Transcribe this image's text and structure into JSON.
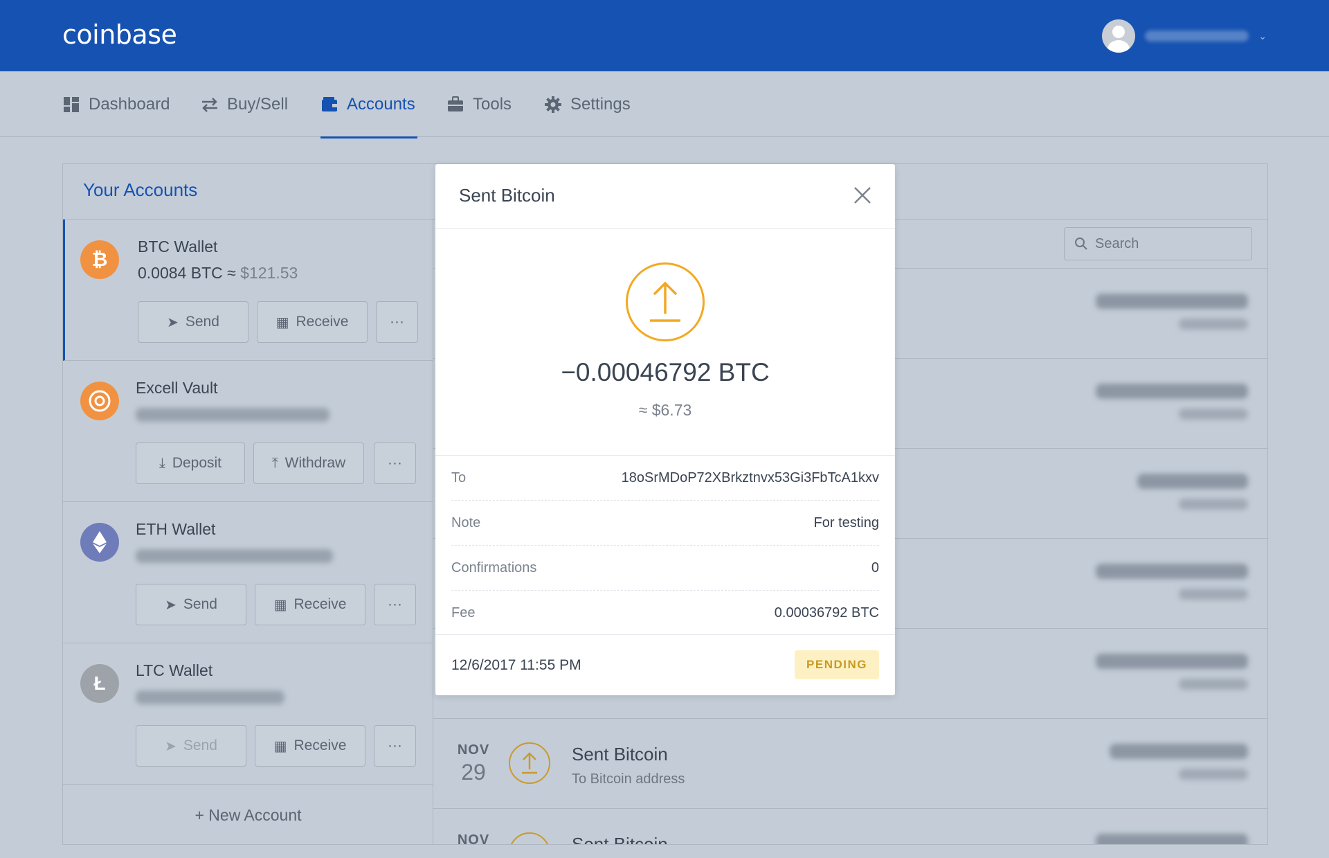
{
  "app": {
    "logo": "coinbase"
  },
  "nav": {
    "items": [
      {
        "label": "Dashboard",
        "icon": "dashboard-icon"
      },
      {
        "label": "Buy/Sell",
        "icon": "exchange-arrows-icon"
      },
      {
        "label": "Accounts",
        "icon": "wallet-icon",
        "active": true
      },
      {
        "label": "Tools",
        "icon": "briefcase-icon"
      },
      {
        "label": "Settings",
        "icon": "gear-icon"
      }
    ]
  },
  "accounts": {
    "title": "Your Accounts",
    "list": [
      {
        "name": "BTC Wallet",
        "balance": "0.0084 BTC ≈ ",
        "fiat": "$121.53",
        "coin_color": "#f09242",
        "icon": "bitcoin-icon",
        "buttons": [
          "Send",
          "Receive",
          "···"
        ]
      },
      {
        "name": "Excell Vault",
        "coin_color": "#f09242",
        "icon": "vault-icon",
        "buttons": [
          "Deposit",
          "Withdraw",
          "···"
        ]
      },
      {
        "name": "ETH Wallet",
        "coin_color": "#6f7cba",
        "icon": "ethereum-icon",
        "buttons": [
          "Send",
          "Receive",
          "···"
        ]
      },
      {
        "name": "LTC Wallet",
        "coin_color": "#b5b5b5",
        "icon": "litecoin-icon",
        "buttons": [
          "Send",
          "Receive",
          "···"
        ]
      }
    ],
    "new_account": "+ New Account"
  },
  "transactions": {
    "search_placeholder": "Search",
    "visible": [
      {
        "month": "NOV",
        "day": "29",
        "title": "Sent Bitcoin",
        "subtitle": "To Bitcoin address"
      },
      {
        "month": "NOV",
        "title": "Sent Bitcoin"
      }
    ]
  },
  "modal": {
    "title": "Sent Bitcoin",
    "amount": "−0.00046792 BTC",
    "fiat": "≈ $6.73",
    "details": [
      {
        "label": "To",
        "value": "18oSrMDoP72XBrkztnvx53Gi3FbTcA1kxv"
      },
      {
        "label": "Note",
        "value": "For testing"
      },
      {
        "label": "Confirmations",
        "value": "0"
      },
      {
        "label": "Fee",
        "value": "0.00036792 BTC"
      }
    ],
    "date": "12/6/2017 11:55 PM",
    "status": "PENDING"
  },
  "colors": {
    "brand": "#1652b2",
    "pending": "#f2a922"
  }
}
